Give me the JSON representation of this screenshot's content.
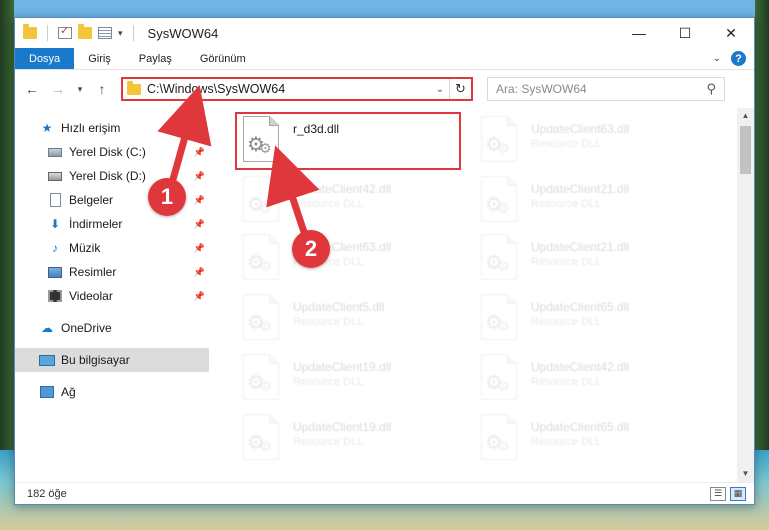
{
  "window": {
    "title": "SysWOW64",
    "controls": [
      "—",
      "☐",
      "✕"
    ]
  },
  "ribbon": {
    "tabs": [
      "Dosya",
      "Giriş",
      "Paylaş",
      "Görünüm"
    ],
    "help_label": "?"
  },
  "address": {
    "path": "C:\\Windows\\SysWOW64",
    "search_placeholder": "Ara: SysWOW64"
  },
  "sidebar": {
    "items": [
      {
        "label": "Hızlı erişim",
        "icon": "star-icon"
      },
      {
        "label": "Yerel Disk (C:)",
        "icon": "disk-icon"
      },
      {
        "label": "Yerel Disk (D:)",
        "icon": "disk-icon"
      },
      {
        "label": "Belgeler",
        "icon": "documents-icon"
      },
      {
        "label": "İndirmeler",
        "icon": "download-icon"
      },
      {
        "label": "Müzik",
        "icon": "music-icon"
      },
      {
        "label": "Resimler",
        "icon": "pictures-icon"
      },
      {
        "label": "Videolar",
        "icon": "videos-icon"
      },
      {
        "label": "OneDrive",
        "icon": "cloud-icon"
      },
      {
        "label": "Bu bilgisayar",
        "icon": "computer-icon"
      },
      {
        "label": "Ağ",
        "icon": "network-icon"
      }
    ]
  },
  "files": {
    "highlighted": {
      "name": "r_d3d.dll",
      "type": ""
    },
    "faded": [
      {
        "name": "UpdateClient63.dll",
        "type": "Resource DLL"
      },
      {
        "name": "UpdateClient42.dll",
        "type": "Resource DLL"
      },
      {
        "name": "UpdateClient21.dll",
        "type": "Resource DLL"
      },
      {
        "name": "UpdateClient63.dll",
        "type": "Resource DLL"
      },
      {
        "name": "UpdateClient21.dll",
        "type": "Resource DLL"
      },
      {
        "name": "UpdateClient5.dll",
        "type": "Resource DLL"
      },
      {
        "name": "UpdateClient65.dll",
        "type": "Resource DLL"
      },
      {
        "name": "UpdateClient19.dll",
        "type": "Resource DLL"
      },
      {
        "name": "UpdateClient42.dll",
        "type": "Resource DLL"
      },
      {
        "name": "UpdateClient19.dll",
        "type": "Resource DLL"
      },
      {
        "name": "UpdateClient65.dll",
        "type": "Resource DLL"
      }
    ]
  },
  "status": {
    "count": "182 öğe"
  },
  "annotations": {
    "step1": "1",
    "step2": "2"
  },
  "colors": {
    "accent": "#1979ca",
    "highlight": "#e0373c"
  }
}
